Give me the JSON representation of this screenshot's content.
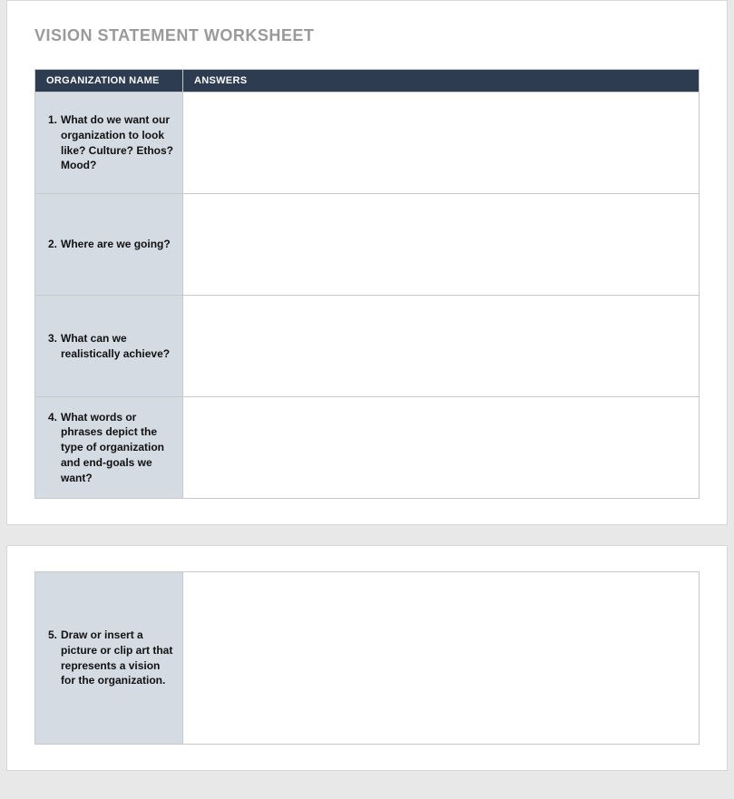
{
  "title": "VISION STATEMENT WORKSHEET",
  "headers": {
    "question_col": "ORGANIZATION NAME",
    "answer_col": "ANSWERS"
  },
  "rows_page1": [
    {
      "num": "1.",
      "question": "What do we want our organization to look like? Culture? Ethos? Mood?",
      "answer": ""
    },
    {
      "num": "2.",
      "question": "Where are we going?",
      "answer": ""
    },
    {
      "num": "3.",
      "question": "What can we realistically achieve?",
      "answer": ""
    },
    {
      "num": "4.",
      "question": "What words or phrases depict the type of organization and end-goals we want?",
      "answer": ""
    }
  ],
  "rows_page2": [
    {
      "num": "5.",
      "question": "Draw or insert a picture or clip art that represents a vision for the organization.",
      "answer": ""
    }
  ]
}
